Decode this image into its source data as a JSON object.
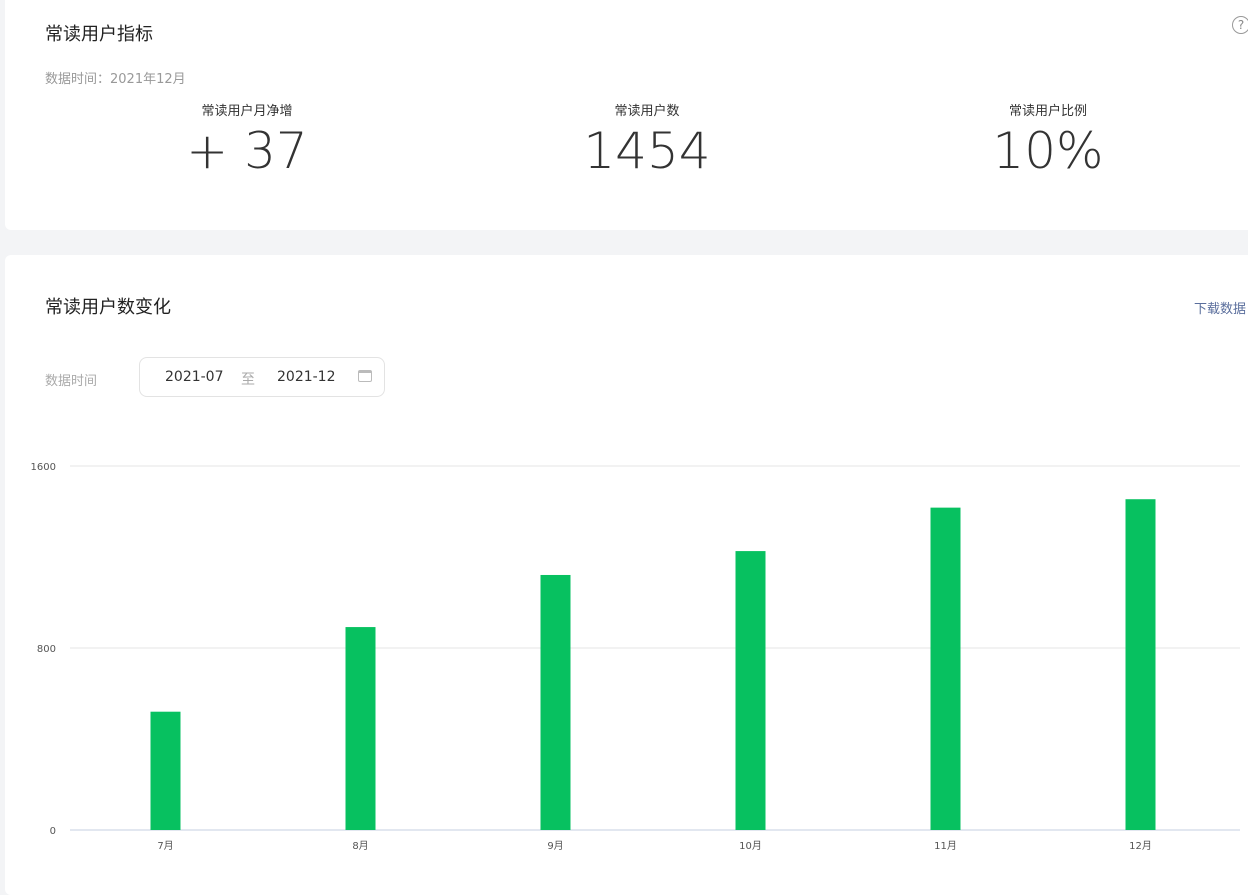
{
  "metrics_card": {
    "title": "常读用户指标",
    "data_time": "数据时间：2021年12月",
    "help_icon": "?",
    "metrics": [
      {
        "label": "常读用户月净增",
        "value": "+ 37"
      },
      {
        "label": "常读用户数",
        "value": "1454"
      },
      {
        "label": "常读用户比例",
        "value": "10%"
      }
    ]
  },
  "trend_card": {
    "title": "常读用户数变化",
    "download": "下载数据",
    "date_label": "数据时间",
    "start": "2021-07",
    "sep": "至",
    "end": "2021-12"
  },
  "chart_data": {
    "type": "bar",
    "categories": [
      "7月",
      "8月",
      "9月",
      "10月",
      "11月",
      "12月"
    ],
    "values": [
      520,
      892,
      1121,
      1226,
      1417,
      1454
    ],
    "ylim": [
      0,
      1600
    ],
    "yticks": [
      "0",
      "800",
      "1600"
    ],
    "color": "#07c160",
    "grid": true
  }
}
